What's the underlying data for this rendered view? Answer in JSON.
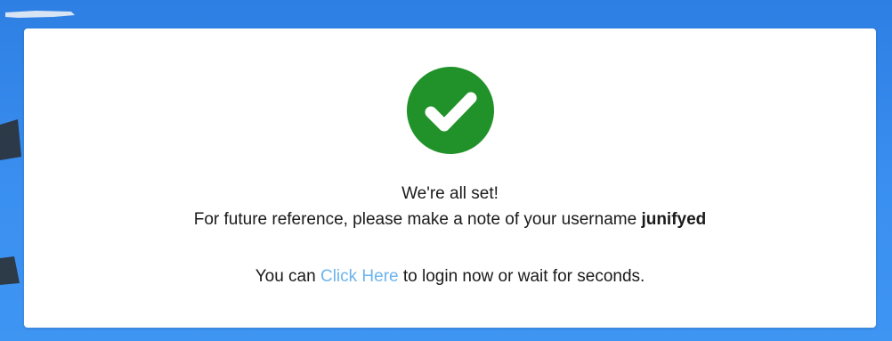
{
  "theme": {
    "background": "#2f86e8",
    "card_background": "#ffffff",
    "success_green": "#21922a",
    "link_color": "#6cb4ee",
    "text_color": "#1a1a1a"
  },
  "success_icon": "check-circle-icon",
  "message": {
    "title": "We're all set!",
    "note_prefix": "For future reference, please make a note of your username",
    "username": "junifyed",
    "login_prefix": "You can",
    "login_link_label": "Click Here",
    "login_suffix": "to login now or wait for seconds."
  }
}
